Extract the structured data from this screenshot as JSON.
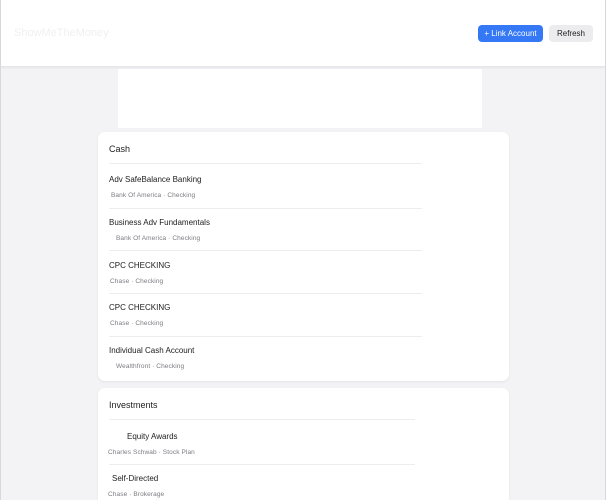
{
  "app": {
    "brand": "ShowMeTheMoney",
    "link_account_label": "+ Link Account",
    "refresh_label": "Refresh"
  },
  "sections": [
    {
      "title": "Cash",
      "accounts": [
        {
          "name": "Adv SafeBalance Banking",
          "detail": "Bank Of America · Checking"
        },
        {
          "name": "Business Adv Fundamentals",
          "detail": "Bank Of America · Checking"
        },
        {
          "name": "CPC CHECKING",
          "detail": "Chase · Checking"
        },
        {
          "name": "CPC CHECKING",
          "detail": "Chase · Checking"
        },
        {
          "name": "Individual Cash Account",
          "detail": "Wealthfront · Checking"
        }
      ]
    },
    {
      "title": "Investments",
      "accounts": [
        {
          "name": "Equity Awards",
          "detail": "Charles Schwab · Stock Plan"
        },
        {
          "name": "Self-Directed",
          "detail": "Chase · Brokerage"
        }
      ]
    }
  ]
}
